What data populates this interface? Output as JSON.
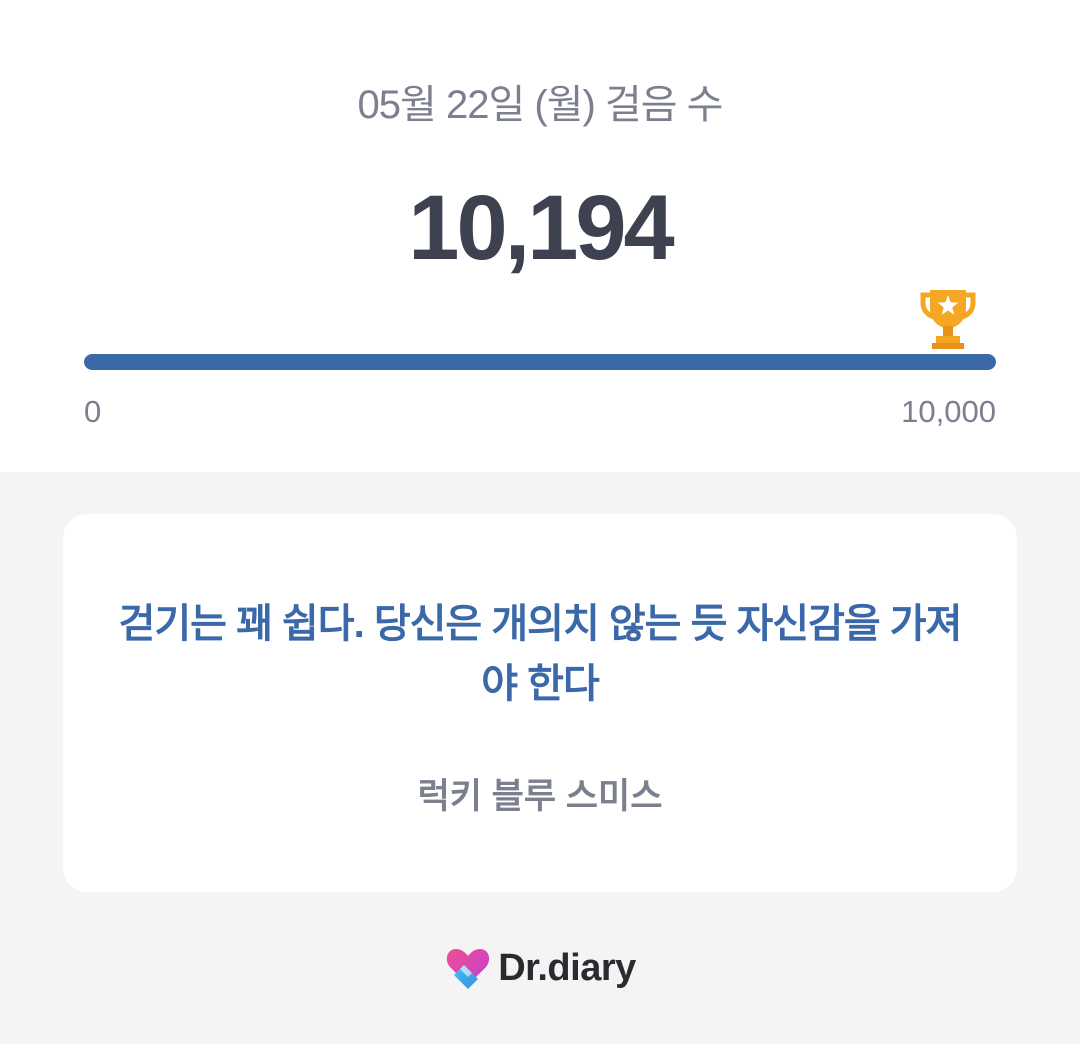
{
  "header": {
    "date_title": "05월 22일 (월) 걸음 수",
    "step_count": "10,194"
  },
  "progress": {
    "min_label": "0",
    "max_label": "10,000",
    "fraction": 1.0,
    "goal_icon": "trophy-icon",
    "fill_color": "#3b68a8"
  },
  "quote": {
    "text": "걷기는 꽤 쉽다. 당신은 개의치 않는 듯 자신감을 가져야 한다",
    "author": "럭키 블루 스미스"
  },
  "brand": {
    "logo_icon": "heart-logo-icon",
    "name": "Dr.diary"
  }
}
